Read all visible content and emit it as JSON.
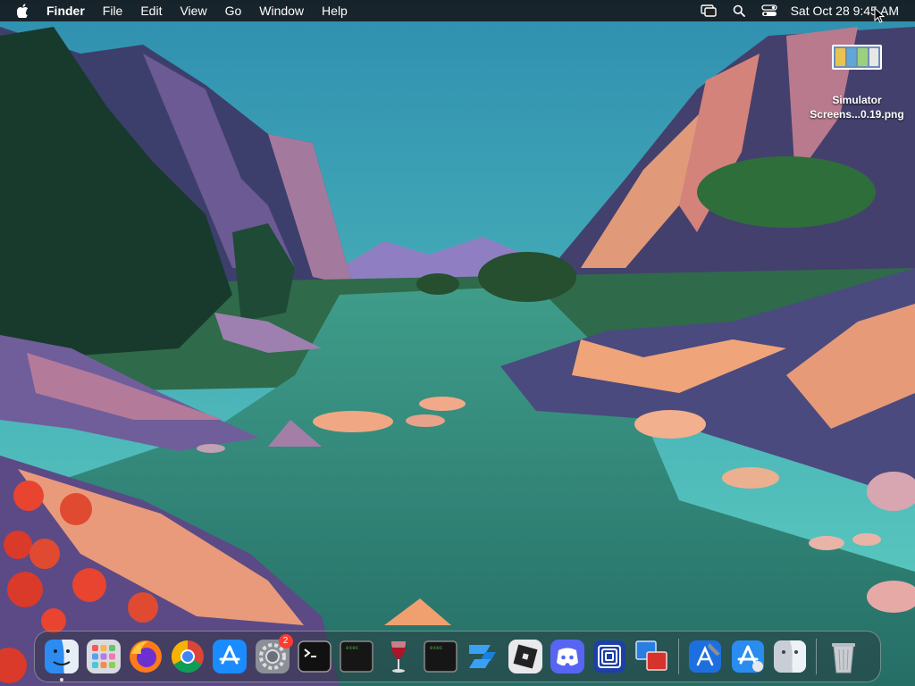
{
  "menubar": {
    "app_name": "Finder",
    "menus": [
      "File",
      "Edit",
      "View",
      "Go",
      "Window",
      "Help"
    ],
    "clock": "Sat Oct 28  9:45 AM",
    "status_icons": [
      "screen-mirroring-icon",
      "spotlight-search-icon",
      "control-center-icon"
    ]
  },
  "desktop": {
    "file_name_line1": "Simulator",
    "file_name_line2": "Screens...0.19.png"
  },
  "dock": {
    "apps": [
      "Finder",
      "Launchpad",
      "Firefox",
      "Google Chrome",
      "App Store",
      "System Settings",
      "Terminal",
      "exec",
      "Wine",
      "exec",
      "Roblox Studio",
      "Roblox",
      "Discord",
      "Frame",
      "Remote Desktop"
    ],
    "system_settings_badge": "2",
    "exec_label": "exec"
  },
  "colors": {
    "sky_top": "#2f8fb0",
    "sky_bottom": "#59c7b9",
    "water": "#2f7d72",
    "rock_highlight": "#f0a47a",
    "badge": "#ff3b30"
  }
}
